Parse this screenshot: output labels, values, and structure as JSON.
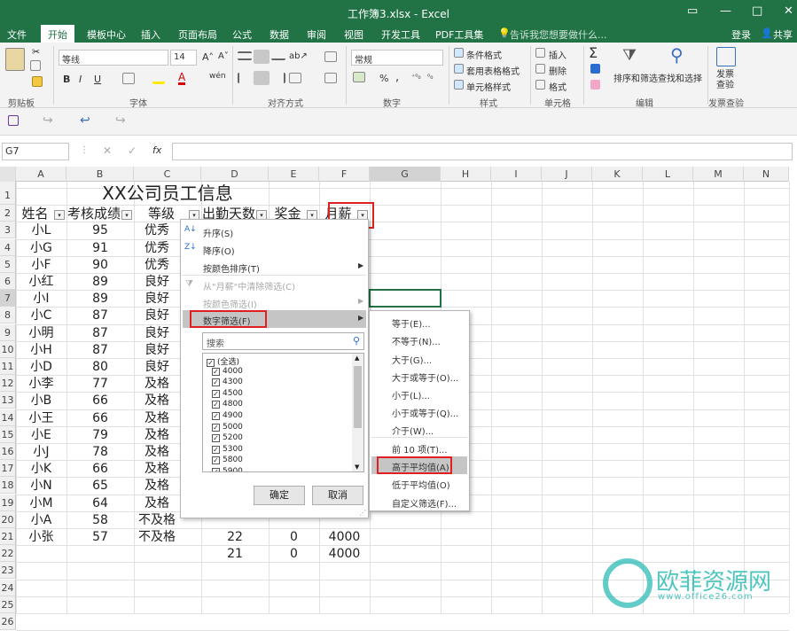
{
  "window": {
    "title": "工作簿3.xlsx - Excel",
    "min": "▭",
    "restore": "—",
    "max": "□",
    "close": "✕"
  },
  "menu": {
    "items": [
      "文件",
      "开始",
      "模板中心",
      "插入",
      "页面布局",
      "公式",
      "数据",
      "审阅",
      "视图",
      "开发工具",
      "PDF工具集"
    ],
    "tell": "告诉我您想要做什么...",
    "login": "登录",
    "share": "共享"
  },
  "ribbon": {
    "font_name": "等线",
    "font_size": "14",
    "number_format": "常规",
    "groups": {
      "clipboard": "剪贴板",
      "font": "字体",
      "align": "对齐方式",
      "number": "数字",
      "styles": "样式",
      "cells": "单元格",
      "edit": "编辑",
      "invoice": "发票查验"
    },
    "styles_items": [
      "条件格式",
      "套用表格格式",
      "单元格样式"
    ],
    "cells_items": [
      "插入",
      "删除",
      "格式"
    ],
    "edit_items": [
      "排序和筛选",
      "查找和选择"
    ],
    "invoice_label": "发票查验",
    "font_btns": [
      "B",
      "I",
      "U"
    ],
    "percent": "%",
    "comma": ","
  },
  "formula_bar": {
    "name_box": "G7",
    "fx": "fx",
    "value": ""
  },
  "columns": [
    "A",
    "B",
    "C",
    "D",
    "E",
    "F",
    "G",
    "H",
    "I",
    "J",
    "K",
    "L",
    "M",
    "N"
  ],
  "rows": [
    "1",
    "2",
    "3",
    "4",
    "5",
    "6",
    "7",
    "8",
    "9",
    "10",
    "11",
    "12",
    "13",
    "14",
    "15",
    "16",
    "17",
    "18",
    "19",
    "20",
    "21",
    "22",
    "23",
    "24",
    "25",
    "26"
  ],
  "sheet": {
    "title": "XX公司员工信息",
    "headers": [
      "姓名",
      "考核成绩",
      "等级",
      "出勤天数",
      "奖金",
      "月薪"
    ],
    "names": [
      "小L",
      "小G",
      "小F",
      "小红",
      "小I",
      "小C",
      "小明",
      "小H",
      "小D",
      "小李",
      "小B",
      "小王",
      "小E",
      "小J",
      "小K",
      "小N",
      "小M",
      "小A",
      "小张"
    ],
    "scores": [
      "95",
      "91",
      "90",
      "89",
      "89",
      "87",
      "87",
      "87",
      "80",
      "77",
      "66",
      "66",
      "79",
      "78",
      "66",
      "65",
      "64",
      "58",
      "57"
    ],
    "grades": [
      "优秀",
      "优秀",
      "优秀",
      "良好",
      "良好",
      "良好",
      "良好",
      "良好",
      "良好",
      "及格",
      "及格",
      "及格",
      "及格",
      "及格",
      "及格",
      "及格",
      "及格",
      "不及格",
      "不及格"
    ],
    "row20": {
      "days": "22",
      "bonus": "0",
      "salary": "4000"
    },
    "row21": {
      "days": "21",
      "bonus": "0",
      "salary": "4000"
    }
  },
  "dropdown": {
    "sort_asc": "升序(S)",
    "sort_desc": "降序(O)",
    "sort_color": "按颜色排序(T)",
    "clear": "从\"月薪\"中清除筛选(C)",
    "filter_color": "按颜色筛选(I)",
    "number_filter": "数字筛选(F)",
    "search_placeholder": "搜索",
    "checks": [
      "(全选)",
      "4000",
      "4300",
      "4500",
      "4800",
      "4900",
      "5000",
      "5200",
      "5300",
      "5800",
      "5900"
    ],
    "ok": "确定",
    "cancel": "取消"
  },
  "submenu": {
    "items": [
      "等于(E)...",
      "不等于(N)...",
      "大于(G)...",
      "大于或等于(O)...",
      "小于(L)...",
      "小于或等于(Q)...",
      "介于(W)...",
      "前 10 项(T)...",
      "高于平均值(A)",
      "低于平均值(O)",
      "自定义筛选(F)..."
    ]
  },
  "watermark": {
    "text": "欧菲资源网",
    "url": "www.office26.com"
  },
  "colors": {
    "excel_green": "#217346",
    "highlight_red": "#e02020",
    "menu_hover": "#c5c5c5",
    "watermark": "#20b8b0"
  }
}
